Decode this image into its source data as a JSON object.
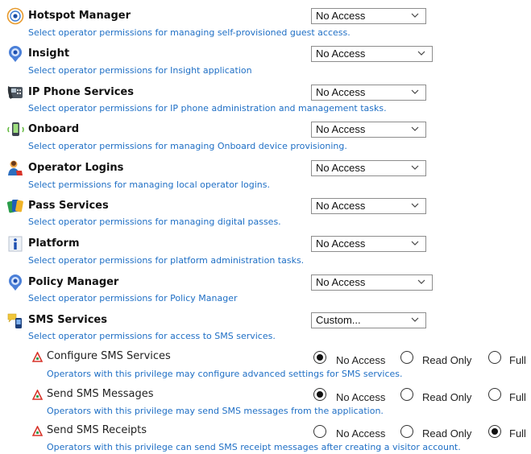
{
  "sections": [
    {
      "icon": "hotspot-icon",
      "title": "Hotspot Manager",
      "desc": "Select operator permissions for managing self-provisioned guest access.",
      "value": "No Access"
    },
    {
      "icon": "insight-icon",
      "title": "Insight",
      "desc": "Select operator permissions for Insight application",
      "value": "No Access"
    },
    {
      "icon": "ip-phone-icon",
      "title": "IP Phone Services",
      "desc": "Select operator permissions for IP phone administration and management tasks.",
      "value": "No Access"
    },
    {
      "icon": "onboard-icon",
      "title": "Onboard",
      "desc": "Select operator permissions for managing Onboard device provisioning.",
      "value": "No Access"
    },
    {
      "icon": "operator-logins-icon",
      "title": "Operator Logins",
      "desc": "Select permissions for managing local operator logins.",
      "value": "No Access"
    },
    {
      "icon": "pass-services-icon",
      "title": "Pass Services",
      "desc": "Select operator permissions for managing digital passes.",
      "value": "No Access"
    },
    {
      "icon": "platform-info-icon",
      "title": "Platform",
      "desc": "Select operator permissions for platform administration tasks.",
      "value": "No Access"
    },
    {
      "icon": "policy-manager-icon",
      "title": "Policy Manager",
      "desc": "Select operator permissions for Policy Manager",
      "value": "No Access"
    },
    {
      "icon": "sms-services-icon",
      "title": "SMS Services",
      "desc": "Select operator permissions for access to SMS services.",
      "value": "Custom..."
    }
  ],
  "radio_labels": {
    "no_access": "No Access",
    "read_only": "Read Only",
    "full": "Full"
  },
  "privileges": [
    {
      "title": "Configure SMS Services",
      "desc": "Operators with this privilege may configure advanced settings for SMS services.",
      "selected": "no_access"
    },
    {
      "title": "Send SMS Messages",
      "desc": "Operators with this privilege may send SMS messages from the application.",
      "selected": "no_access"
    },
    {
      "title": "Send SMS Receipts",
      "desc": "Operators with this privilege can send SMS receipt messages after creating a visitor account.",
      "selected": "full"
    }
  ]
}
